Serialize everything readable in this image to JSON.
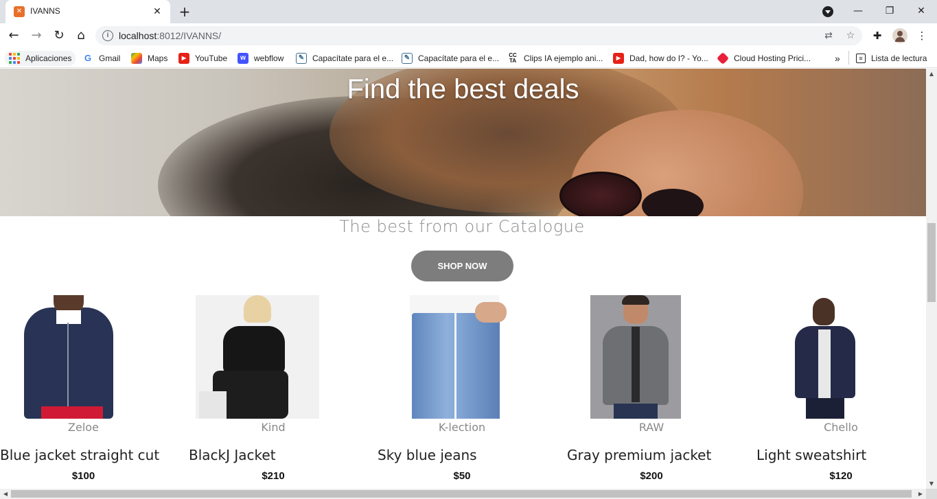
{
  "browser": {
    "tab_title": "IVANNS",
    "tab_favicon_icon": "xampp-icon",
    "url_host": "localhost",
    "url_rest": ":8012/IVANNS/",
    "bookmarks": [
      {
        "label": "Aplicaciones",
        "icon": "apps-grid-icon"
      },
      {
        "label": "Gmail",
        "icon": "google-icon"
      },
      {
        "label": "Maps",
        "icon": "maps-icon"
      },
      {
        "label": "YouTube",
        "icon": "youtube-icon"
      },
      {
        "label": "webflow",
        "icon": "webflow-icon"
      },
      {
        "label": "Capacítate para el e...",
        "icon": "edit-icon"
      },
      {
        "label": "Capacítate para el e...",
        "icon": "edit-icon"
      },
      {
        "label": "Clips IA ejemplo ani...",
        "icon": "cc-icon"
      },
      {
        "label": "Dad, how do I? - Yo...",
        "icon": "youtube-icon"
      },
      {
        "label": "Cloud Hosting Prici...",
        "icon": "cube-icon"
      }
    ],
    "more_bookmarks": "»",
    "reading_list": "Lista de lectura"
  },
  "hero": {
    "title": "Find the best deals"
  },
  "catalogue": {
    "title": "The best from our Catalogue",
    "shop_button": "SHOP NOW"
  },
  "products": [
    {
      "brand": "Zeloe",
      "name": "Blue jacket straight cut",
      "price": "$100"
    },
    {
      "brand": "Kind",
      "name": "BlackJ Jacket",
      "price": "$210"
    },
    {
      "brand": "K-lection",
      "name": "Sky blue jeans",
      "price": "$50"
    },
    {
      "brand": "RAW",
      "name": "Gray premium jacket",
      "price": "$200"
    },
    {
      "brand": "Chello",
      "name": "Light sweatshirt",
      "price": "$120"
    }
  ],
  "colors": {
    "button_bg": "#7d7d7d",
    "muted_text": "#888888",
    "hero_text": "#ffffff"
  }
}
